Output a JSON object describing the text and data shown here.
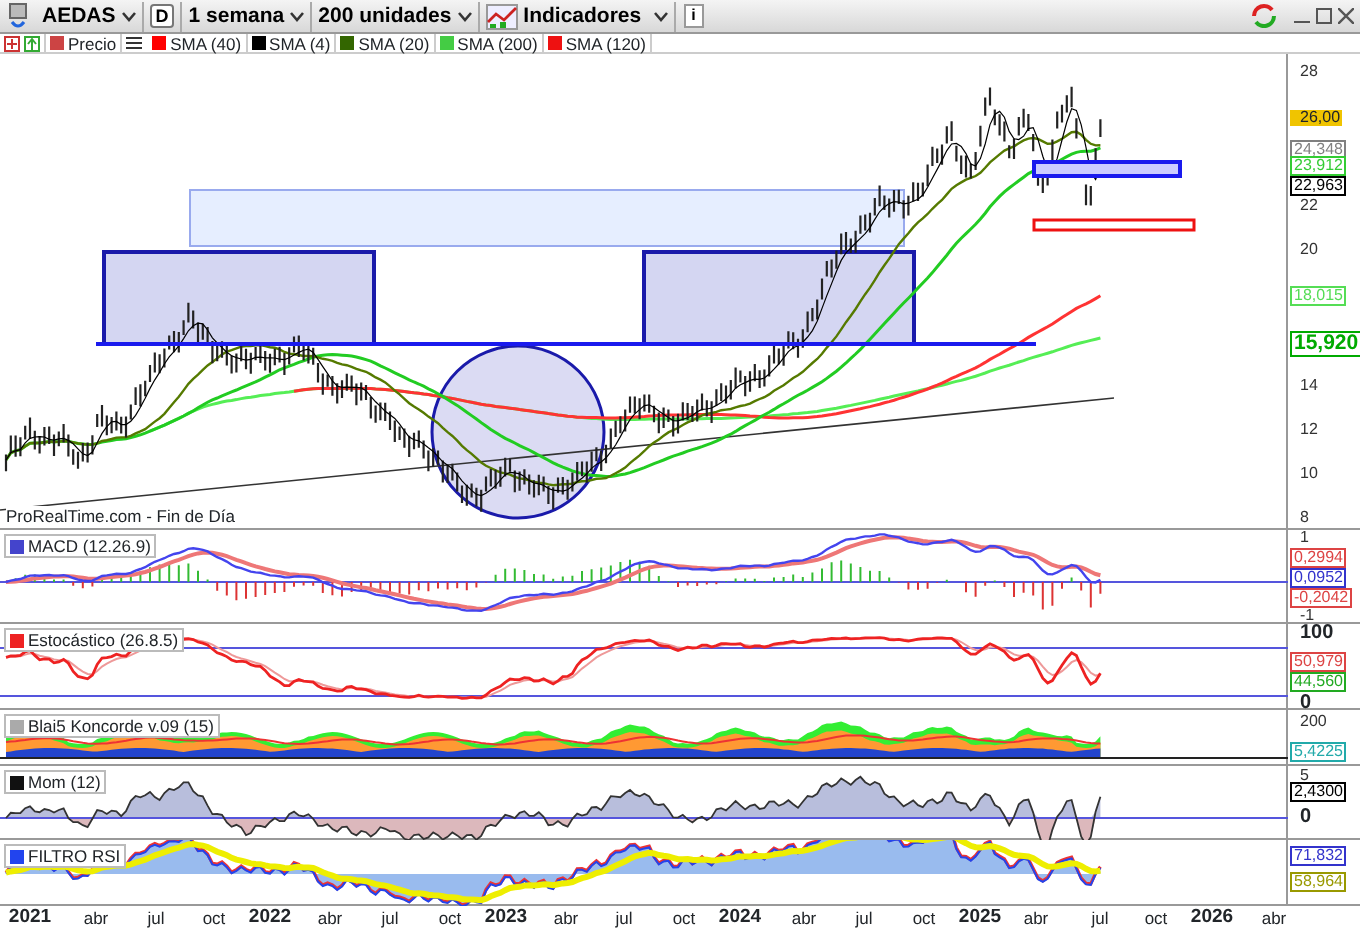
{
  "toolbar": {
    "symbol": "AEDAS",
    "period_button": "D",
    "timeframe": "1 semana",
    "units": "200 unidades",
    "indicators": "Indicadores",
    "info_button": "i"
  },
  "legend": [
    {
      "label": "Precio",
      "color": "#cc4444"
    },
    {
      "label": "SMA (40)",
      "color": "#ff0000"
    },
    {
      "label": "SMA (4)",
      "color": "#000000"
    },
    {
      "label": "SMA (20)",
      "color": "#336600"
    },
    {
      "label": "SMA (200)",
      "color": "#44cc44"
    },
    {
      "label": "SMA (120)",
      "color": "#ee1111"
    }
  ],
  "main_chart": {
    "source_label": "ProRealTime.com - Fin de Día",
    "axis": [
      {
        "label": "28",
        "kind": "tick"
      },
      {
        "label": "26,00",
        "kind": "last"
      },
      {
        "label": "24,348",
        "kind": "value",
        "color": "#808080"
      },
      {
        "label": "23,912",
        "kind": "value",
        "color": "#33cc33"
      },
      {
        "label": "22,963",
        "kind": "value",
        "color": "#000000"
      },
      {
        "label": "22",
        "kind": "tick"
      },
      {
        "label": "20",
        "kind": "tick"
      },
      {
        "label": "18,015",
        "kind": "value",
        "color": "#55dd55"
      },
      {
        "label": "15,920",
        "kind": "big",
        "color": "#00aa00"
      },
      {
        "label": "14",
        "kind": "tick"
      },
      {
        "label": "12",
        "kind": "tick"
      },
      {
        "label": "10",
        "kind": "tick"
      },
      {
        "label": "8",
        "kind": "tick"
      }
    ]
  },
  "panels": [
    {
      "title": "MACD (12.26.9)",
      "color": "#4444cc",
      "axis": [
        {
          "label": "1",
          "kind": "tick"
        },
        {
          "label": "0,2994",
          "kind": "value",
          "color": "#dd4444"
        },
        {
          "label": "0,0952",
          "kind": "value",
          "color": "#3333cc"
        },
        {
          "label": "-0,2042",
          "kind": "value",
          "color": "#dd4444"
        },
        {
          "label": "-1",
          "kind": "tick"
        }
      ]
    },
    {
      "title": "Estocástico (26.8.5)",
      "color": "#ee2222",
      "axis": [
        {
          "label": "100",
          "kind": "bigtick"
        },
        {
          "label": "50,979",
          "kind": "value",
          "color": "#dd4444"
        },
        {
          "label": "44,560",
          "kind": "value",
          "color": "#22aa22"
        },
        {
          "label": "0",
          "kind": "bigtick"
        }
      ]
    },
    {
      "title": "Blai5 Koncorde v.09 (15)",
      "color": "#aaaaaa",
      "axis": [
        {
          "label": "200",
          "kind": "tick"
        },
        {
          "label": "5,4225",
          "kind": "value",
          "color": "#22aaaa"
        }
      ]
    },
    {
      "title": "Mom (12)",
      "color": "#111111",
      "axis": [
        {
          "label": "5",
          "kind": "tick"
        },
        {
          "label": "2,4300",
          "kind": "value",
          "color": "#000000"
        },
        {
          "label": "0",
          "kind": "bigtick"
        }
      ]
    },
    {
      "title": "FILTRO RSI",
      "color": "#2244ee",
      "axis": [
        {
          "label": "71,832",
          "kind": "value",
          "color": "#3333cc"
        },
        {
          "label": "58,964",
          "kind": "value",
          "color": "#999900"
        }
      ]
    }
  ],
  "x_axis": [
    {
      "label": "2021",
      "kind": "year"
    },
    {
      "label": "abr",
      "kind": "month"
    },
    {
      "label": "jul",
      "kind": "month"
    },
    {
      "label": "oct",
      "kind": "month"
    },
    {
      "label": "2022",
      "kind": "year"
    },
    {
      "label": "abr",
      "kind": "month"
    },
    {
      "label": "jul",
      "kind": "month"
    },
    {
      "label": "oct",
      "kind": "month"
    },
    {
      "label": "2023",
      "kind": "year"
    },
    {
      "label": "abr",
      "kind": "month"
    },
    {
      "label": "jul",
      "kind": "month"
    },
    {
      "label": "oct",
      "kind": "month"
    },
    {
      "label": "2024",
      "kind": "year"
    },
    {
      "label": "abr",
      "kind": "month"
    },
    {
      "label": "jul",
      "kind": "month"
    },
    {
      "label": "oct",
      "kind": "month"
    },
    {
      "label": "2025",
      "kind": "year"
    },
    {
      "label": "abr",
      "kind": "month"
    },
    {
      "label": "jul",
      "kind": "month"
    },
    {
      "label": "oct",
      "kind": "month"
    },
    {
      "label": "2026",
      "kind": "year"
    },
    {
      "label": "abr",
      "kind": "month"
    }
  ]
}
